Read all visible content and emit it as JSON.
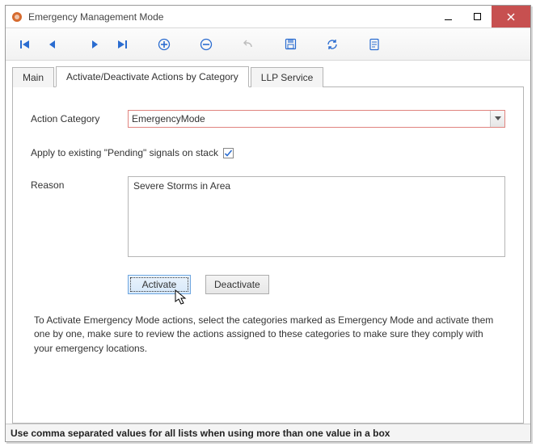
{
  "window": {
    "title": "Emergency Management Mode"
  },
  "toolbar": {
    "first": "first-icon",
    "prev": "prev-icon",
    "next": "next-icon",
    "last": "last-icon",
    "add": "add-icon",
    "remove": "remove-icon",
    "undo": "undo-icon",
    "save": "save-icon",
    "refresh": "refresh-icon",
    "report": "report-icon"
  },
  "tabs": {
    "main": "Main",
    "activate": "Activate/Deactivate Actions by Category",
    "llp": "LLP Service",
    "active_index": 1
  },
  "form": {
    "category_label": "Action Category",
    "category_value": "EmergencyMode",
    "apply_label": "Apply to existing \"Pending\" signals on stack",
    "apply_checked": true,
    "reason_label": "Reason",
    "reason_value": "Severe Storms in Area",
    "activate_btn": "Activate",
    "deactivate_btn": "Deactivate",
    "help": "To Activate Emergency Mode actions, select the categories marked as Emergency Mode and activate them one by one, make sure to review the actions assigned to these categories to make sure they comply with your emergency locations."
  },
  "status": "Use comma separated values for all lists when using more than one value in a box"
}
